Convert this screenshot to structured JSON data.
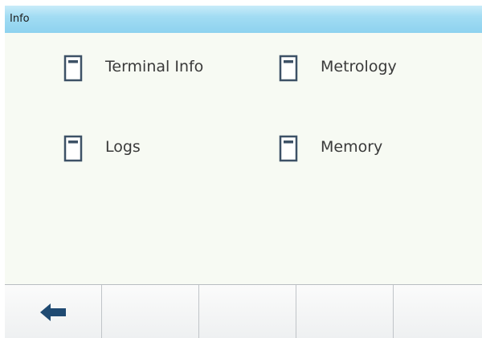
{
  "window": {
    "title": "Info"
  },
  "menu": {
    "items": [
      {
        "label": "Terminal Info",
        "icon": "document-icon"
      },
      {
        "label": "Metrology",
        "icon": "document-icon"
      },
      {
        "label": "Logs",
        "icon": "document-icon"
      },
      {
        "label": "Memory",
        "icon": "document-icon"
      }
    ]
  },
  "softkeys": [
    {
      "icon": "back-arrow-icon"
    },
    {
      "icon": ""
    },
    {
      "icon": ""
    },
    {
      "icon": ""
    },
    {
      "icon": ""
    }
  ],
  "colors": {
    "title_bar": "#8ed2ef",
    "content_background": "#f7faf3",
    "icon_stroke": "#3d5166",
    "arrow": "#1f4a72"
  }
}
